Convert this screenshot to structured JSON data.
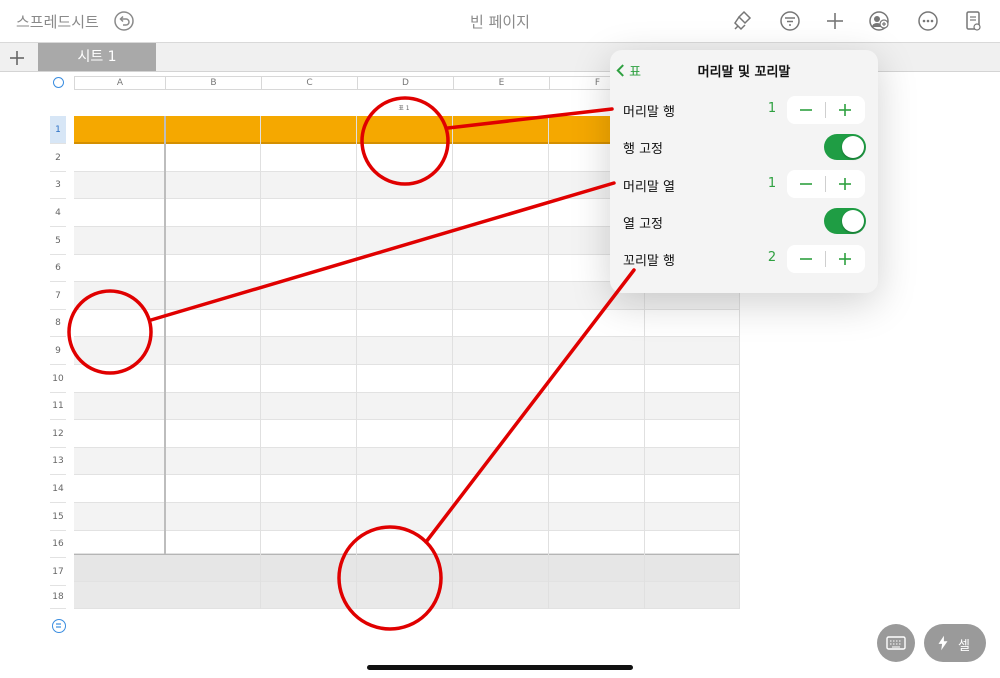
{
  "toolbar": {
    "back_label": "스프레드시트",
    "title": "빈 페이지",
    "icons": [
      "undo-icon",
      "paintbrush-icon",
      "filter-icon",
      "plus-icon",
      "collaborate-icon",
      "more-icon",
      "document-view-icon"
    ]
  },
  "sheets": {
    "tabs": [
      {
        "label": "시트 1"
      }
    ]
  },
  "table": {
    "name": "표 1",
    "columns": [
      "A",
      "B",
      "C",
      "D",
      "E",
      "F"
    ],
    "rows": [
      "1",
      "2",
      "3",
      "4",
      "5",
      "6",
      "7",
      "8",
      "9",
      "10",
      "11",
      "12",
      "13",
      "14",
      "15",
      "16",
      "17",
      "18"
    ],
    "header_color": "#f5a800"
  },
  "popover": {
    "back_label": "표",
    "title": "머리말 및 꼬리말",
    "items": [
      {
        "label": "머리말 행",
        "value": "1"
      },
      {
        "label": "행 고정",
        "on": true
      },
      {
        "label": "머리말 열",
        "value": "1"
      },
      {
        "label": "열 고정",
        "on": true
      },
      {
        "label": "꼬리말 행",
        "value": "2"
      }
    ],
    "minus": "−",
    "plus": "+"
  },
  "bottom": {
    "cell_label": "셀"
  },
  "colors": {
    "accent": "#2ea040",
    "annotation": "#e00000"
  }
}
